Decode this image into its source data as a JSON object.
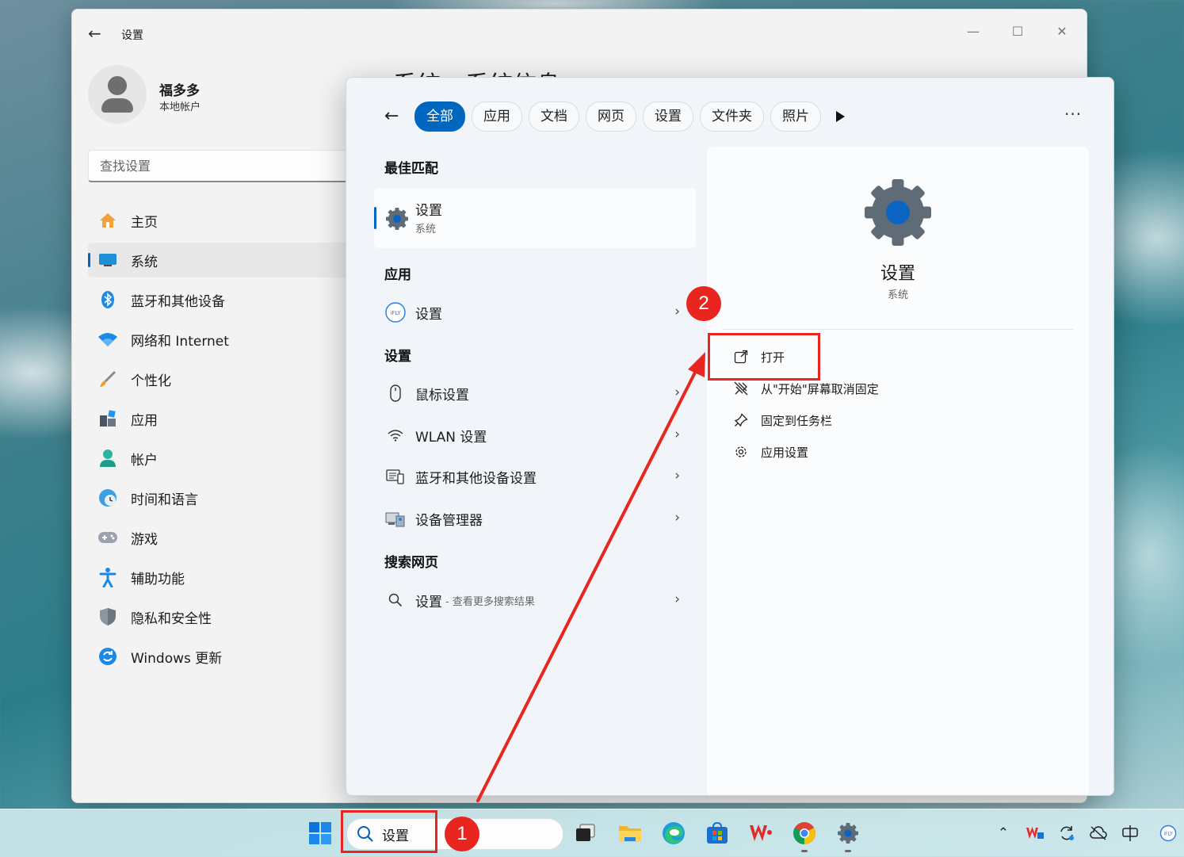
{
  "settings": {
    "app_title": "设置",
    "bg_heading": "系统  ›  系统信息",
    "profile": {
      "name": "福多多",
      "account_type": "本地帐户"
    },
    "search_placeholder": "查找设置",
    "nav": [
      {
        "label": "主页",
        "icon": "home-icon"
      },
      {
        "label": "系统",
        "icon": "system-icon",
        "active": true
      },
      {
        "label": "蓝牙和其他设备",
        "icon": "bluetooth-icon"
      },
      {
        "label": "网络和 Internet",
        "icon": "wifi-icon"
      },
      {
        "label": "个性化",
        "icon": "brush-icon"
      },
      {
        "label": "应用",
        "icon": "apps-icon"
      },
      {
        "label": "帐户",
        "icon": "account-icon"
      },
      {
        "label": "时间和语言",
        "icon": "clock-globe-icon"
      },
      {
        "label": "游戏",
        "icon": "gamepad-icon"
      },
      {
        "label": "辅助功能",
        "icon": "accessibility-icon"
      },
      {
        "label": "隐私和安全性",
        "icon": "shield-icon"
      },
      {
        "label": "Windows 更新",
        "icon": "update-icon"
      }
    ]
  },
  "search": {
    "filters": [
      "全部",
      "应用",
      "文档",
      "网页",
      "设置",
      "文件夹",
      "照片"
    ],
    "best_match": {
      "section": "最佳匹配",
      "title": "设置",
      "subtitle": "系统"
    },
    "apps_section": "应用",
    "apps": [
      {
        "label": "设置",
        "icon": "ifly-icon"
      }
    ],
    "settings_section": "设置",
    "settings_results": [
      {
        "label": "鼠标设置",
        "icon": "mouse-icon"
      },
      {
        "label": "WLAN 设置",
        "icon": "wifi-icon"
      },
      {
        "label": "蓝牙和其他设备设置",
        "icon": "devices-icon"
      },
      {
        "label": "设备管理器",
        "icon": "device-manager-icon"
      }
    ],
    "web_section": "搜索网页",
    "web": {
      "label": "设置",
      "sub": "- 查看更多搜索结果"
    },
    "detail": {
      "title": "设置",
      "subtitle": "系统",
      "actions": [
        {
          "label": "打开",
          "icon": "open-external-icon"
        },
        {
          "label": "从\"开始\"屏幕取消固定",
          "icon": "unpin-icon"
        },
        {
          "label": "固定到任务栏",
          "icon": "pin-icon"
        },
        {
          "label": "应用设置",
          "icon": "gear-icon"
        }
      ]
    }
  },
  "taskbar": {
    "search_text": "设置"
  },
  "annotations": {
    "step1": "1",
    "step2": "2"
  },
  "colors": {
    "accent": "#0067c0",
    "annotation_red": "#e8261f"
  }
}
